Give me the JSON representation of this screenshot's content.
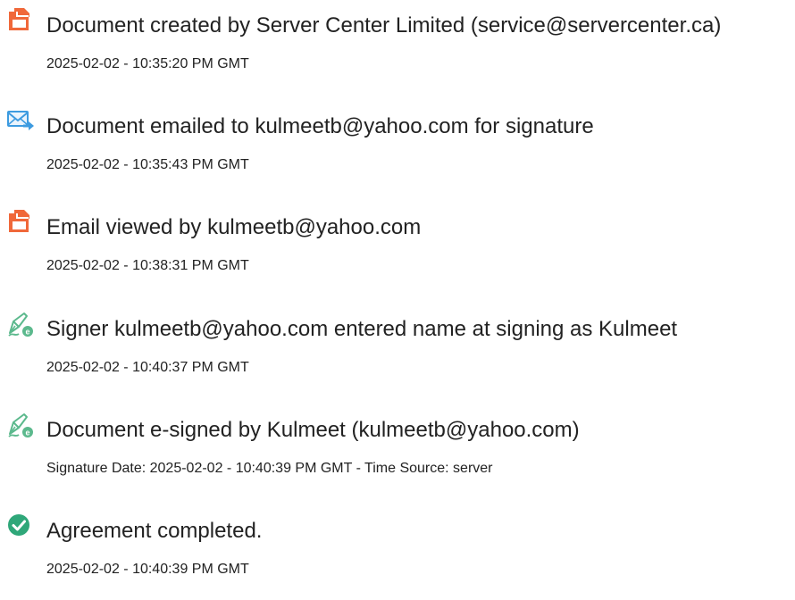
{
  "colors": {
    "document_icon": "#f0683a",
    "email_icon": "#3d9be0",
    "sign_icon": "#5cb98d",
    "complete_icon": "#2fa779",
    "text": "#222222"
  },
  "events": [
    {
      "icon": "document-icon",
      "title": "Document created by Server Center Limited (service@servercenter.ca)",
      "meta": "2025-02-02 - 10:35:20 PM GMT"
    },
    {
      "icon": "email-icon",
      "title": "Document emailed to kulmeetb@yahoo.com for signature",
      "meta": "2025-02-02 - 10:35:43 PM GMT"
    },
    {
      "icon": "document-icon",
      "title": "Email viewed by kulmeetb@yahoo.com",
      "meta": "2025-02-02 - 10:38:31 PM GMT"
    },
    {
      "icon": "e-sign-icon",
      "title": "Signer kulmeetb@yahoo.com entered name at signing as Kulmeet",
      "meta": "2025-02-02 - 10:40:37 PM GMT"
    },
    {
      "icon": "e-sign-icon",
      "title": "Document e-signed by Kulmeet (kulmeetb@yahoo.com)",
      "meta": "Signature Date: 2025-02-02 - 10:40:39 PM GMT - Time Source: server"
    },
    {
      "icon": "check-circle-icon",
      "title": "Agreement completed.",
      "meta": "2025-02-02 - 10:40:39 PM GMT"
    }
  ]
}
